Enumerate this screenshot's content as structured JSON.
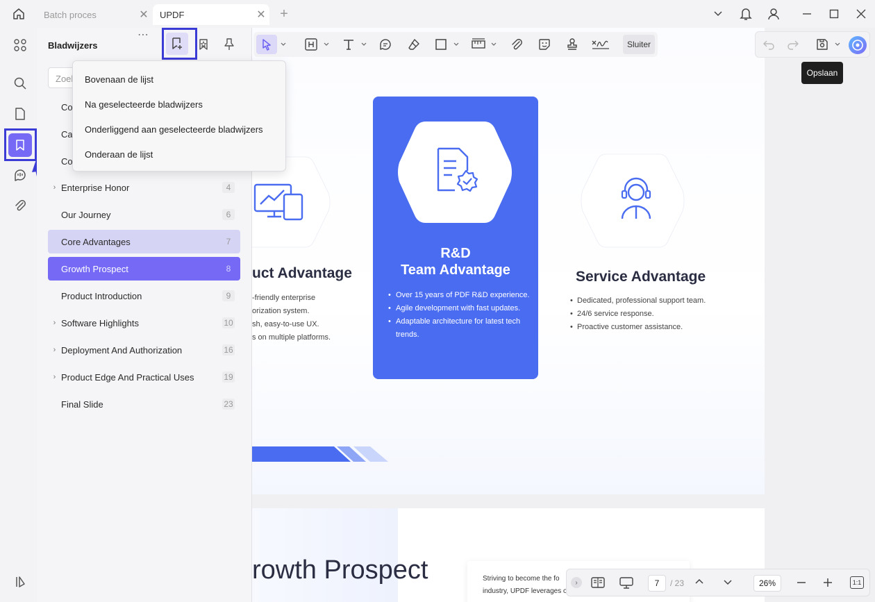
{
  "tabs": [
    {
      "label": "Batch proces"
    },
    {
      "label": "UPDF"
    }
  ],
  "bookmarks_panel": {
    "title": "Bladwijzers",
    "search_placeholder": "Zoek",
    "partial_rows": [
      "Co",
      "Ca",
      "Co"
    ],
    "items": [
      {
        "label": "Enterprise Honor",
        "page": "4",
        "expandable": true
      },
      {
        "label": "Our Journey",
        "page": "6",
        "expandable": false
      },
      {
        "label": "Core Advantages",
        "page": "7",
        "expandable": false
      },
      {
        "label": "Growth Prospect",
        "page": "8",
        "expandable": false
      },
      {
        "label": "Product Introduction",
        "page": "9",
        "expandable": false
      },
      {
        "label": "Software Highlights",
        "page": "10",
        "expandable": true
      },
      {
        "label": "Deployment And Authorization",
        "page": "16",
        "expandable": true
      },
      {
        "label": "Product Edge And Practical Uses",
        "page": "19",
        "expandable": true
      },
      {
        "label": "Final Slide",
        "page": "23",
        "expandable": false
      }
    ]
  },
  "dropdown": {
    "items": [
      "Bovenaan de lijst",
      "Na geselecteerde bladwijzers",
      "Onderliggend aan geselecteerde bladwijzers",
      "Onderaan de lijst"
    ]
  },
  "toolbar": {
    "close_label": "Sluiter"
  },
  "tooltip": {
    "save": "Opslaan"
  },
  "page1": {
    "product": {
      "title": "uct Advantage",
      "bullets": [
        "-friendly enterprise",
        "orization system.",
        "sh, easy-to-use UX.",
        "s on multiple platforms."
      ]
    },
    "rd": {
      "title_line1": "R&D",
      "title_line2": "Team Advantage",
      "bullets": [
        "Over 15 years of PDF R&D experience.",
        "Agile development with fast updates.",
        "Adaptable architecture for latest tech",
        "trends."
      ]
    },
    "service": {
      "title": "Service Advantage",
      "bullets": [
        "Dedicated, professional support team.",
        "24/6 service response.",
        "Proactive customer assistance."
      ]
    }
  },
  "page2": {
    "title": "rowth Prospect",
    "text_line1": "Striving to become the fo",
    "text_line2": "industry, UPDF leverages o"
  },
  "bottombar": {
    "current_page": "7",
    "total_pages": "/ 23",
    "zoom": "26%",
    "fit_label": "1:1"
  },
  "colors": {
    "accent": "#7569f5",
    "highlight_box": "#3b3bd6",
    "card_blue": "#4a6cf0"
  }
}
